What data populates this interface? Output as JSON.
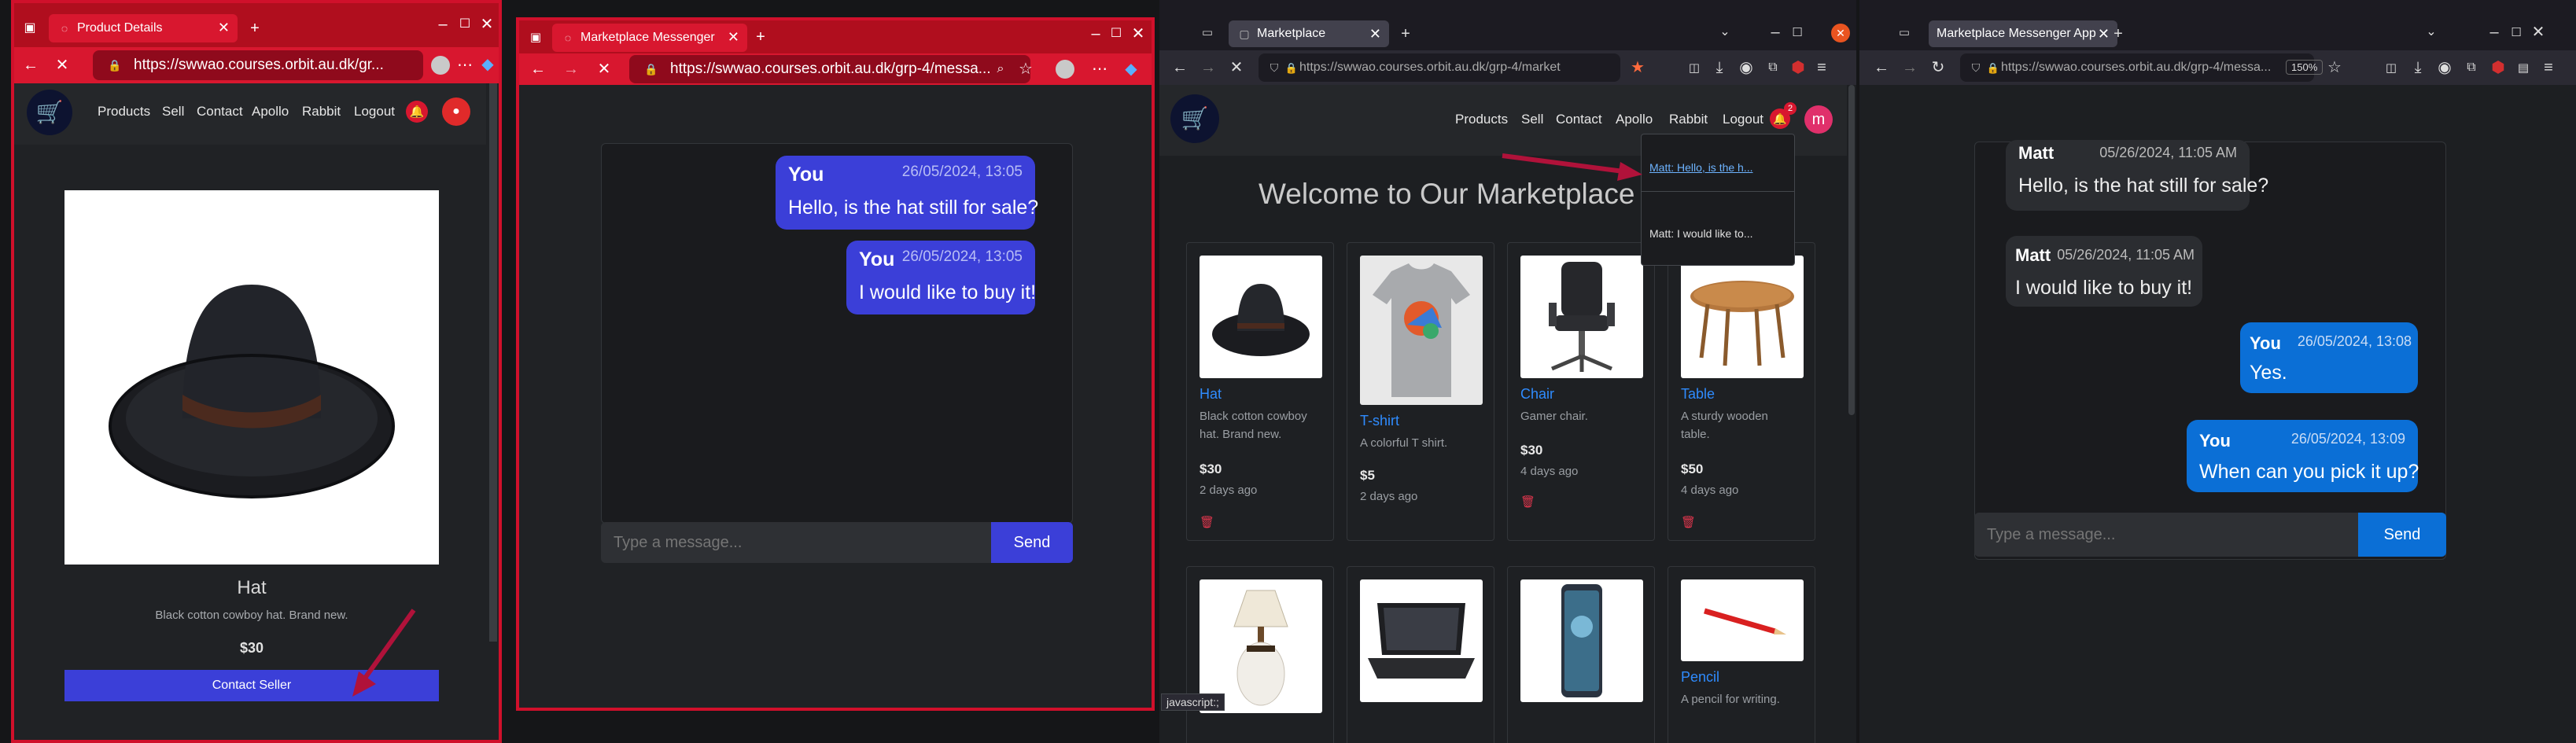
{
  "window1": {
    "tab_title": "Product Details",
    "url": "https://swwao.courses.orbit.au.dk/gr...",
    "nav": [
      "Products",
      "Sell",
      "Contact",
      "Apollo",
      "Rabbit",
      "Logout"
    ],
    "product": {
      "name": "Hat",
      "description": "Black cotton cowboy hat. Brand new.",
      "price": "$30",
      "contact_button": "Contact Seller"
    }
  },
  "window2": {
    "tab_title": "Marketplace Messenger",
    "url": "https://swwao.courses.orbit.au.dk/grp-4/messa...",
    "messages": [
      {
        "sender": "You",
        "timestamp": "26/05/2024, 13:05",
        "text": "Hello, is the hat still for sale?"
      },
      {
        "sender": "You",
        "timestamp": "26/05/2024, 13:05",
        "text": "I would like to buy it!"
      }
    ],
    "input_placeholder": "Type a message...",
    "send_label": "Send"
  },
  "window3": {
    "tab_title": "Marketplace",
    "url": "https://swwao.courses.orbit.au.dk/grp-4/market",
    "nav": [
      "Products",
      "Sell",
      "Contact",
      "Apollo",
      "Rabbit",
      "Logout"
    ],
    "notification_badge": "2",
    "avatar_letter": "m",
    "heading": "Welcome to Our Marketplace",
    "notifications": [
      "Matt: Hello, is the h...",
      "Matt: I would like to..."
    ],
    "status_text": "javascript:;",
    "products": [
      {
        "name": "Hat",
        "description": "Black cotton cowboy hat. Brand new.",
        "price": "$30",
        "age": "2 days ago"
      },
      {
        "name": "T-shirt",
        "description": "A colorful T shirt.",
        "price": "$5",
        "age": "2 days ago"
      },
      {
        "name": "Chair",
        "description": "Gamer chair.",
        "price": "$30",
        "age": "4 days ago"
      },
      {
        "name": "Table",
        "description": "A sturdy wooden table.",
        "price": "$50",
        "age": "4 days ago"
      },
      {
        "name": "Pencil",
        "description": "A pencil for writing."
      }
    ]
  },
  "window4": {
    "tab_title": "Marketplace Messenger App",
    "url": "https://swwao.courses.orbit.au.dk/grp-4/messa...",
    "zoom": "150%",
    "messages": [
      {
        "sender": "Matt",
        "timestamp": "05/26/2024, 11:05 AM",
        "text": "Hello, is the hat still for sale?"
      },
      {
        "sender": "Matt",
        "timestamp": "05/26/2024, 11:05 AM",
        "text": "I would like to buy it!"
      },
      {
        "sender": "You",
        "timestamp": "26/05/2024, 13:08",
        "text": "Yes."
      },
      {
        "sender": "You",
        "timestamp": "26/05/2024, 13:09",
        "text": "When can you pick it up?"
      }
    ],
    "input_placeholder": "Type a message...",
    "send_label": "Send"
  },
  "colors": {
    "red_frame": "#d0102b",
    "primary_blue": "#3b3fd8",
    "firefox_blue": "#0b6fd6",
    "annotation_arrow": "#b0123a"
  }
}
